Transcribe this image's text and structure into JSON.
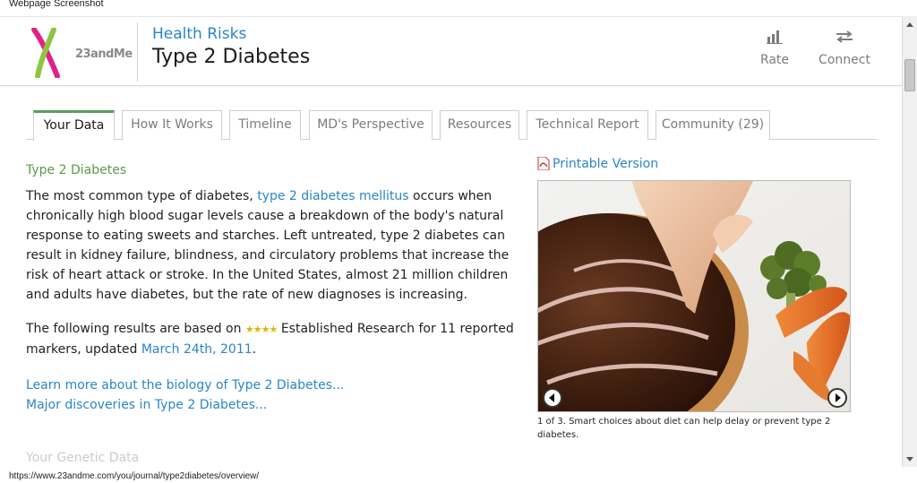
{
  "window": {
    "title": "Webpage Screenshot"
  },
  "header": {
    "logo_text": "23andMe",
    "section_link": "Health Risks",
    "page_title": "Type 2 Diabetes",
    "tools": [
      {
        "label": "Rate",
        "icon": "bar-chart-icon"
      },
      {
        "label": "Connect",
        "icon": "connect-arrows-icon"
      }
    ]
  },
  "tabs": [
    {
      "label": "Your Data",
      "active": true
    },
    {
      "label": "How It Works"
    },
    {
      "label": "Timeline"
    },
    {
      "label": "MD's Perspective"
    },
    {
      "label": "Resources"
    },
    {
      "label": "Technical Report"
    },
    {
      "label": "Community (29)"
    }
  ],
  "main": {
    "heading": "Type 2 Diabetes",
    "intro": {
      "before": "The most common type of diabetes, ",
      "link": "type 2 diabetes mellitus",
      "after": " occurs when chronically high blood sugar levels cause a breakdown of the body's natural response to eating sweets and starches. Left untreated, type 2 diabetes can result in kidney failure, blindness, and circulatory problems that increase the risk of heart attack or stroke. In the United States, almost 21 million children and adults have diabetes, but the rate of new diagnoses is increasing."
    },
    "results": {
      "before": "The following results are based on ",
      "stars": "★★★★",
      "research_label": "Established Research",
      "middle": " for 11 reported markers, updated ",
      "date_link": "March 24th, 2011",
      "after": "."
    },
    "links": [
      "Learn more about the biology of Type 2 Diabetes...",
      "Major discoveries in Type 2 Diabetes..."
    ],
    "faded_heading": "Your Genetic Data"
  },
  "sidebar": {
    "printable": "Printable Version",
    "caption": "1 of 3. Smart choices about diet can help delay or prevent type 2 diabetes."
  },
  "status_bar": {
    "url": "https://www.23andme.com/you/journal/type2diabetes/overview/"
  },
  "colors": {
    "link": "#2a86c6",
    "accent_green": "#56a05a",
    "heading_green": "#5a9c4a",
    "star": "#e3b30c"
  }
}
